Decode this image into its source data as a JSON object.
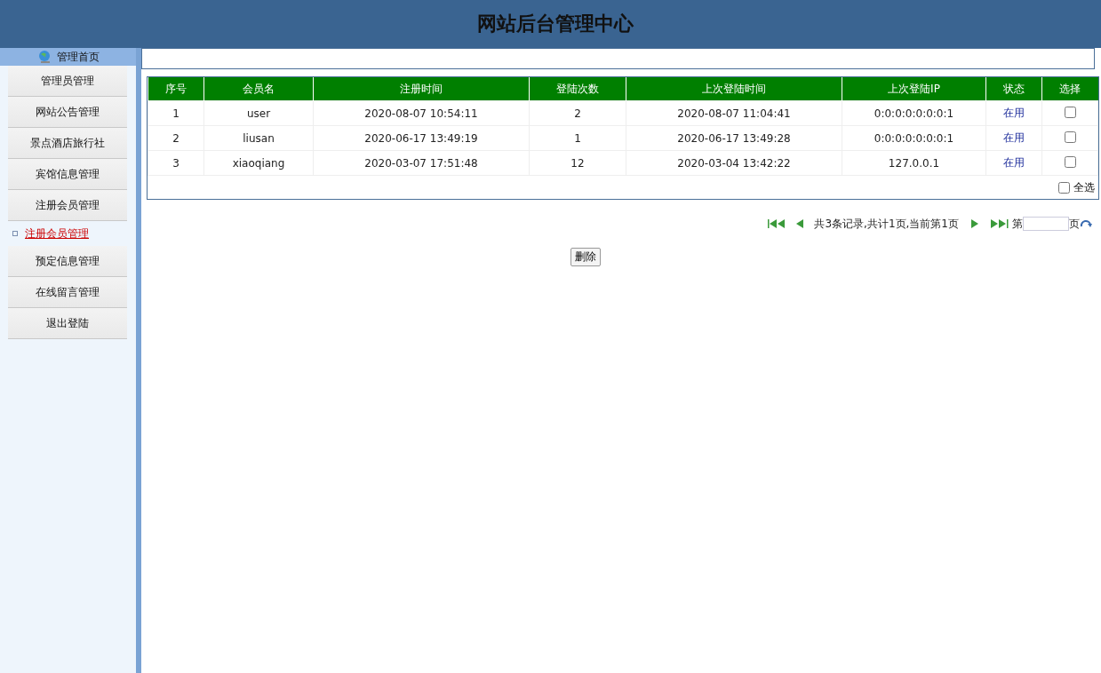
{
  "header": {
    "title": "网站后台管理中心"
  },
  "sidebar": {
    "home": "管理首页",
    "items": [
      {
        "label": "管理员管理",
        "kind": "button"
      },
      {
        "label": "网站公告管理",
        "kind": "button"
      },
      {
        "label": "景点酒店旅行社",
        "kind": "button"
      },
      {
        "label": "宾馆信息管理",
        "kind": "button"
      },
      {
        "label": "注册会员管理",
        "kind": "button"
      },
      {
        "label": "注册会员管理",
        "kind": "sublink"
      },
      {
        "label": "预定信息管理",
        "kind": "button"
      },
      {
        "label": "在线留言管理",
        "kind": "button"
      },
      {
        "label": "退出登陆",
        "kind": "button"
      }
    ]
  },
  "table": {
    "columns": [
      "序号",
      "会员名",
      "注册时间",
      "登陆次数",
      "上次登陆时间",
      "上次登陆IP",
      "状态",
      "选择"
    ],
    "rows": [
      {
        "cells": [
          "1",
          "user",
          "2020-08-07 10:54:11",
          "2",
          "2020-08-07 11:04:41",
          "0:0:0:0:0:0:0:1"
        ],
        "status": "在用",
        "checked": false
      },
      {
        "cells": [
          "2",
          "liusan",
          "2020-06-17 13:49:19",
          "1",
          "2020-06-17 13:49:28",
          "0:0:0:0:0:0:0:1"
        ],
        "status": "在用",
        "checked": false
      },
      {
        "cells": [
          "3",
          "xiaoqiang",
          "2020-03-07 17:51:48",
          "12",
          "2020-03-04 13:42:22",
          "127.0.0.1"
        ],
        "status": "在用",
        "checked": false
      }
    ],
    "select_all": {
      "label": "全选",
      "checked": false
    }
  },
  "pagination": {
    "summary": "共3条记录,共计1页,当前第1页",
    "page_prefix": "第",
    "page_suffix": "页"
  },
  "delete_button": "删除"
}
